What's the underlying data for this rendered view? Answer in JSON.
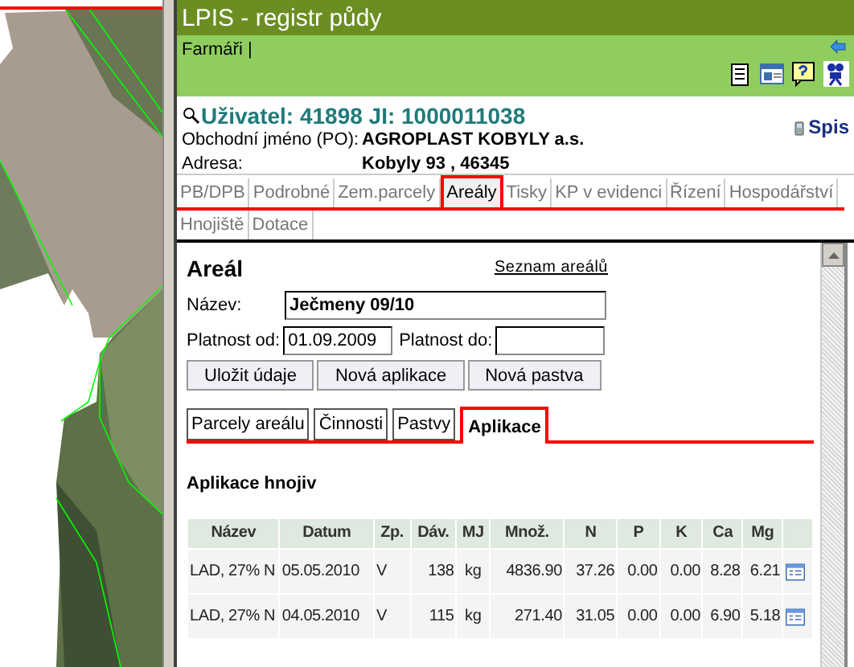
{
  "header": {
    "title": "LPIS - registr půdy",
    "menu": "Farmáři |"
  },
  "user": {
    "heading": "Uživatel: 41898 JI: 1000011038",
    "spis": "Spis",
    "fields": [
      {
        "label": "Obchodní jméno (PO):",
        "value": "AGROPLAST KOBYLY a.s."
      },
      {
        "label": "Adresa:",
        "value": "Kobyly 93 , 46345"
      }
    ]
  },
  "tabs": [
    {
      "label": "PB/DPB",
      "selected": false
    },
    {
      "label": "Podrobné",
      "selected": false
    },
    {
      "label": "Zem.parcely",
      "selected": false
    },
    {
      "label": "Areály",
      "selected": true
    },
    {
      "label": "Tisky",
      "selected": false
    },
    {
      "label": "KP v evidenci",
      "selected": false
    },
    {
      "label": "Řízení",
      "selected": false
    },
    {
      "label": "Hospodářství",
      "selected": false
    },
    {
      "label": "Hnojiště",
      "selected": false
    },
    {
      "label": "Dotace",
      "selected": false
    }
  ],
  "areal": {
    "title": "Areál",
    "list_link": "Seznam areálů",
    "name_label": "Název:",
    "name_value": "Ječmeny 09/10",
    "from_label": "Platnost od:",
    "from_value": "01.09.2009",
    "to_label": "Platnost do:",
    "buttons": [
      "Uložit údaje",
      "Nová aplikace",
      "Nová pastva"
    ],
    "subtabs": [
      {
        "label": "Parcely areálu",
        "selected": false
      },
      {
        "label": "Činnosti",
        "selected": false
      },
      {
        "label": "Pastvy",
        "selected": false
      },
      {
        "label": "Aplikace",
        "selected": true
      }
    ],
    "section_title": "Aplikace hnojiv",
    "table": {
      "columns": [
        "Název",
        "Datum",
        "Zp.",
        "Dáv.",
        "MJ",
        "Množ.",
        "N",
        "P",
        "K",
        "Ca",
        "Mg"
      ],
      "rows": [
        [
          "LAD, 27% N",
          "05.05.2010",
          "V",
          "138",
          "kg",
          "4836.90",
          "37.26",
          "0.00",
          "0.00",
          "8.28",
          "6.21"
        ],
        [
          "LAD, 27% N",
          "04.05.2010",
          "V",
          "115",
          "kg",
          "271.40",
          "31.05",
          "0.00",
          "0.00",
          "6.90",
          "5.18"
        ]
      ]
    }
  }
}
